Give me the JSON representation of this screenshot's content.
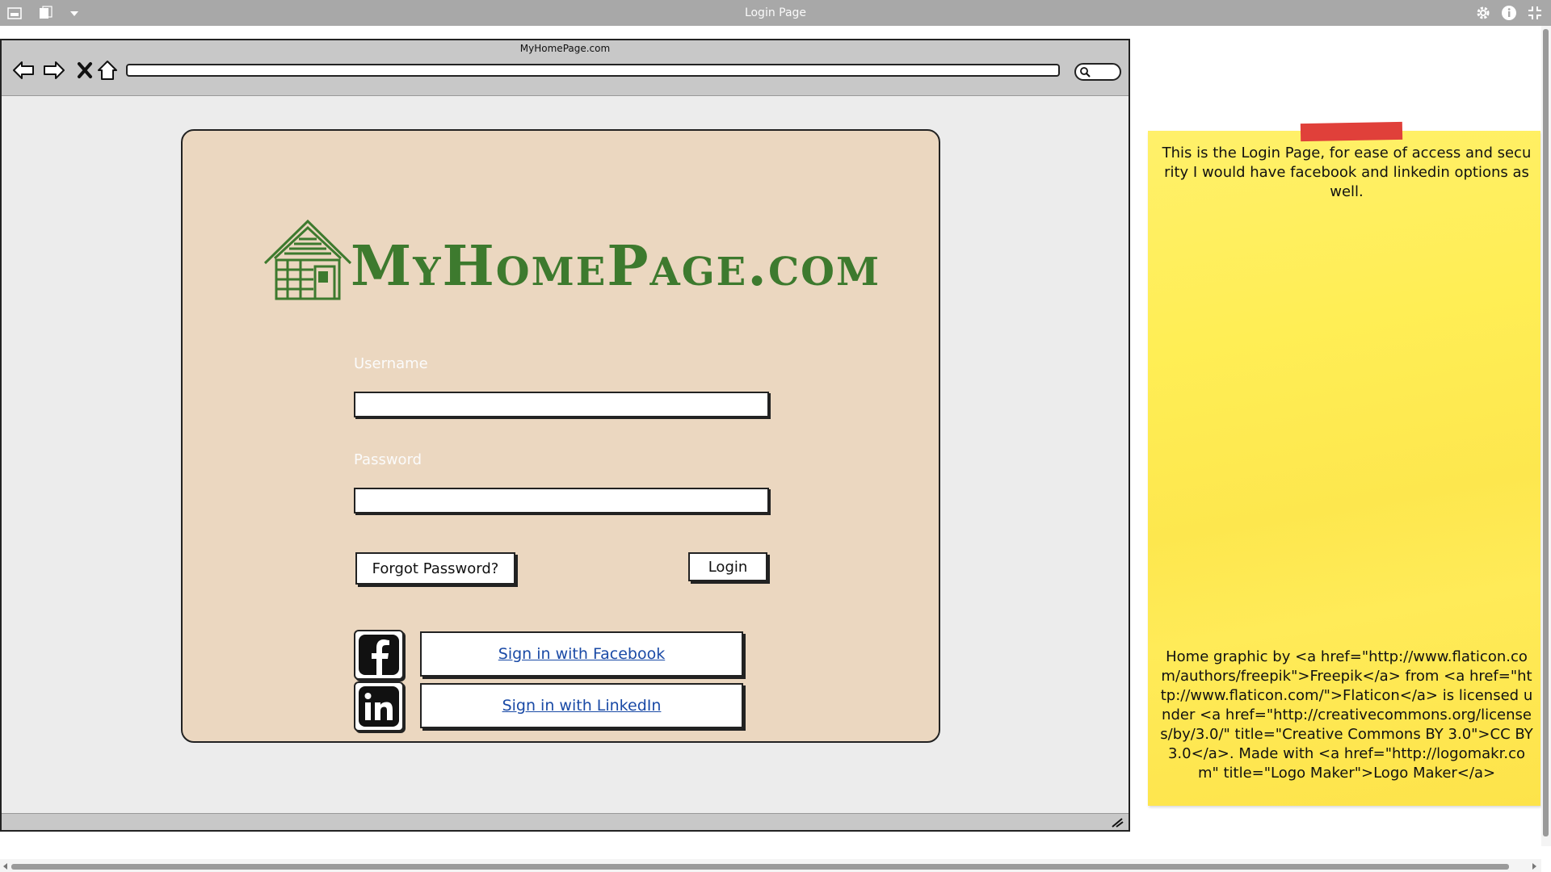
{
  "window": {
    "title": "Login Page"
  },
  "browser": {
    "url_title": "MyHomePage.com",
    "address_value": "",
    "search_value": ""
  },
  "logo": {
    "text": "MyHomePage.com"
  },
  "form": {
    "username_label": "Username",
    "username_value": "",
    "password_label": "Password",
    "password_value": "",
    "forgot_label": "Forgot Password?",
    "login_label": "Login",
    "facebook_label": "Sign in with Facebook",
    "linkedin_label": "Sign in with LinkedIn"
  },
  "sticky_note": {
    "top_text": "This is the Login Page, for ease of access and security I would have facebook and linkedin options as well.",
    "bottom_text": "Home graphic by <a href=\"http://www.flaticon.com/authors/freepik\">Freepik</a> from <a href=\"http://www.flaticon.com/\">Flaticon</a> is licensed under <a href=\"http://creativecommons.org/licenses/by/3.0/\" title=\"Creative Commons BY 3.0\">CC BY 3.0</a>. Made with <a href=\"http://logomakr.com\" title=\"Logo Maker\">Logo Maker</a>"
  },
  "icons": [
    "window-icon",
    "copy-icon",
    "dropdown-arrow-icon",
    "gear-icon",
    "info-icon",
    "collapse-icon",
    "back-arrow-icon",
    "forward-arrow-icon",
    "stop-icon",
    "home-icon",
    "search-icon",
    "house-logo-icon",
    "facebook-icon",
    "linkedin-icon",
    "resize-grip-icon"
  ],
  "colors": {
    "logo_green": "#3d7a2e",
    "card_background": "#ebd7c0",
    "sticky_yellow": "#ffee55",
    "tape_red": "#e0403a",
    "link_blue": "#1a4aa6"
  }
}
